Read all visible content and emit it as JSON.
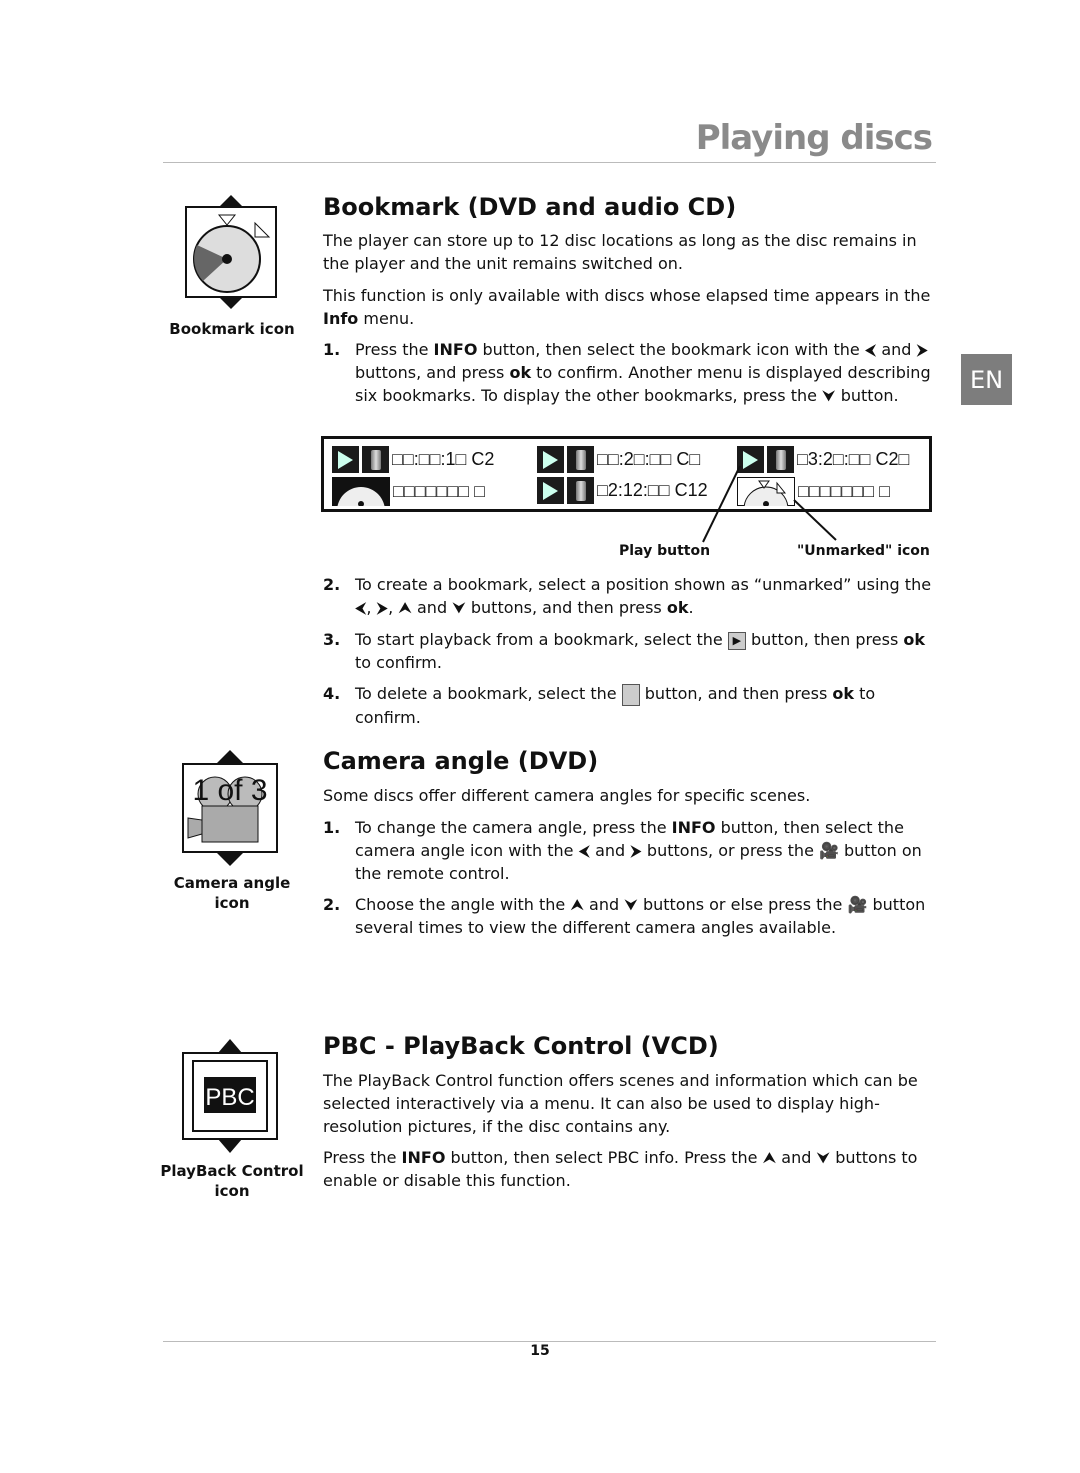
{
  "header": {
    "title": "Playing discs",
    "language_tab": "EN"
  },
  "bookmark": {
    "title": "Bookmark (DVD and audio CD)",
    "icon_caption": "Bookmark icon",
    "p1": "The player can store up to 12 disc locations as long as the disc remains in the player and the unit remains switched on.",
    "p2_a": "This function is only available with discs whose elapsed time appears in the ",
    "p2_b": "Info",
    "p2_c": " menu.",
    "s1": {
      "n": "1.",
      "a": "Press the ",
      "b": "INFO",
      "c": " button, then select the bookmark icon with the ",
      "d": " and ",
      "e": " buttons, and press ",
      "f": "ok",
      "g": " to confirm. Another menu is displayed describing six bookmarks. To display the other bookmarks, press the ",
      "h": " button."
    },
    "osd": [
      {
        "type": "bookmark",
        "text": "□□:□□:1□ C2"
      },
      {
        "type": "bookmark",
        "text": "□□:2□:□□ C□"
      },
      {
        "type": "bookmark",
        "text": "□3:2□:□□ C2□"
      },
      {
        "type": "unmarked",
        "text": "□□□□□□□ □"
      },
      {
        "type": "bookmark",
        "text": "□2:12:□□ C12"
      },
      {
        "type": "unmarked",
        "text": "□□□□□□□ □"
      }
    ],
    "callout_play": "Play button",
    "callout_unmarked": "\"Unmarked\" icon",
    "s2": {
      "n": "2.",
      "a": "To create a bookmark, select a position shown as “unmarked” using the ",
      "b": ", ",
      "c": ", ",
      "d": " and ",
      "e": " buttons, and then press ",
      "f": "ok",
      "g": "."
    },
    "s3": {
      "n": "3.",
      "a": "To start playback from a bookmark, select the ",
      "b": " button, then press ",
      "c": "ok",
      "d": " to confirm."
    },
    "s4": {
      "n": "4.",
      "a": "To delete a bookmark, select the ",
      "b": " button, and then press ",
      "c": "ok",
      "d": " to confirm."
    }
  },
  "camera": {
    "title": "Camera angle (DVD)",
    "icon_caption": "Camera angle icon",
    "icon_text": "1 of 3",
    "p1": "Some discs offer different camera angles for specific scenes.",
    "s1": {
      "n": "1.",
      "a": "To change the camera angle, press the ",
      "b": "INFO",
      "c": " button, then select the camera angle icon with the ",
      "d": " and ",
      "e": " buttons, or press the ",
      "f": " button on the remote control."
    },
    "s2": {
      "n": "2.",
      "a": "Choose the angle with the ",
      "b": " and ",
      "c": " buttons or else press the ",
      "d": " button several times to view the different camera angles available."
    }
  },
  "pbc": {
    "title": "PBC - PlayBack Control (VCD)",
    "icon_caption": "PlayBack Control icon",
    "icon_text": "PBC",
    "p1": "The PlayBack Control function offers scenes and information which can be selected interactively via a menu. It can also be used to display high-resolution pictures, if the disc contains any.",
    "p2": {
      "a": "Press the ",
      "b": "INFO",
      "c": " button, then select PBC info. Press the ",
      "d": " and ",
      "e": " buttons to enable or disable this function."
    }
  },
  "footer": {
    "page_number": "15"
  }
}
